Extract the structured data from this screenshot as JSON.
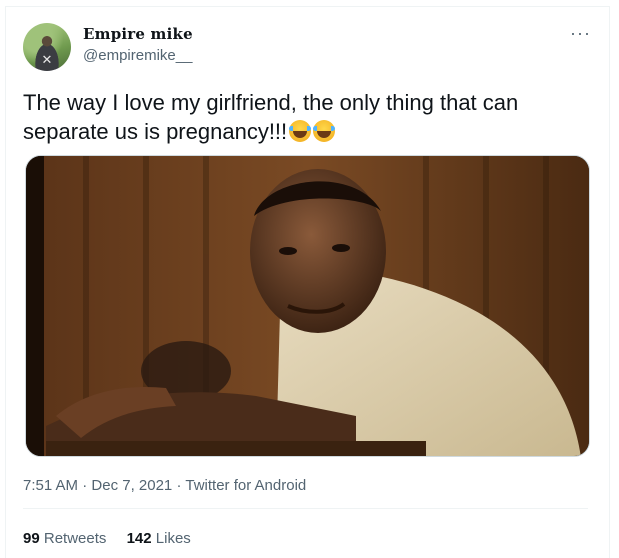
{
  "user": {
    "display_name": "Empire mike",
    "handle": "@empiremike__"
  },
  "tweet": {
    "text": "The way I love my girlfriend, the only thing that can separate us is pregnancy!!!",
    "emojis": [
      "face-with-tears-of-joy",
      "face-with-tears-of-joy"
    ]
  },
  "meta": {
    "time": "7:51 AM",
    "separator": "·",
    "date": "Dec 7, 2021",
    "source": "Twitter for Android"
  },
  "stats": {
    "retweets_count": "99",
    "retweets_label": "Retweets",
    "likes_count": "142",
    "likes_label": "Likes"
  },
  "icons": {
    "more": "more-options-icon"
  }
}
